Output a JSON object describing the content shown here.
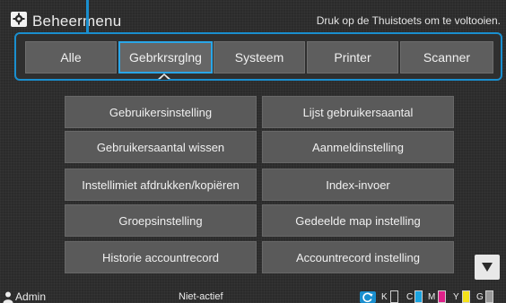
{
  "header": {
    "title": "Beheermenu",
    "hint": "Druk op de Thuistoets om te voltooien."
  },
  "tabs": [
    {
      "label": "Alle",
      "selected": false
    },
    {
      "label": "Gebrkrsrglng",
      "selected": true
    },
    {
      "label": "Systeem",
      "selected": false
    },
    {
      "label": "Printer",
      "selected": false
    },
    {
      "label": "Scanner",
      "selected": false
    }
  ],
  "menu": {
    "items": [
      "Gebruikersinstelling",
      "Lijst gebruikersaantal",
      "Gebruikersaantal wissen",
      "Aanmeldinstelling",
      "Instellimiet afdrukken/kopiëren",
      "Index-invoer",
      "Groepsinstelling",
      "Gedeelde map instelling",
      "Historie accountrecord",
      "Accountrecord instelling"
    ]
  },
  "status": {
    "user": "Admin",
    "state": "Niet-actief",
    "toners": [
      {
        "label": "K",
        "color": "#111111",
        "level": 0
      },
      {
        "label": "C",
        "color": "#1aa3e0",
        "level": 1
      },
      {
        "label": "M",
        "color": "#e0218a",
        "level": 1
      },
      {
        "label": "Y",
        "color": "#f5e21a",
        "level": 1
      },
      {
        "label": "G",
        "color": "#9a9a9a",
        "level": 1
      }
    ]
  },
  "icons": {
    "header": "gear-icon",
    "scroll": "triangle-down-icon",
    "user": "user-icon",
    "toner_refresh": "refresh-icon"
  }
}
